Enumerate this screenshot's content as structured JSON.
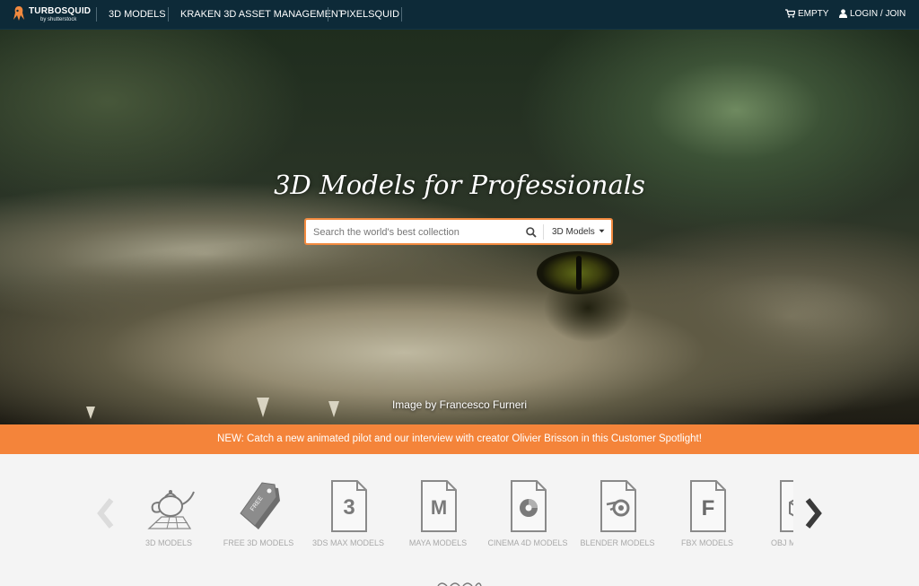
{
  "nav": {
    "logo_text": "TURBOSQUID",
    "logo_sub": "by shutterstock",
    "links": [
      "3D MODELS",
      "KRAKEN 3D ASSET MANAGEMENT",
      "PIXELSQUID"
    ],
    "cart_label": "EMPTY",
    "login_label": "LOGIN / JOIN",
    "cart_icon": "cart-icon",
    "user_icon": "user-icon"
  },
  "hero": {
    "title": "3D Models for Professionals",
    "search": {
      "placeholder": "Search the world's best collection",
      "category": "3D Models",
      "search_icon": "search-icon",
      "caret_icon": "caret-down-icon"
    },
    "credit": "Image by Francesco Furneri"
  },
  "banner": {
    "text": "NEW: Catch a new animated pilot and our interview with creator Olivier Brisson in this Customer Spotlight!"
  },
  "categories": {
    "prev_icon": "chevron-left-icon",
    "next_icon": "chevron-right-icon",
    "items": [
      {
        "label": "3D MODELS",
        "icon": "teapot-icon"
      },
      {
        "label": "FREE 3D MODELS",
        "icon": "free-tag-icon"
      },
      {
        "label": "3DS MAX MODELS",
        "icon": "3dsmax-file-icon"
      },
      {
        "label": "MAYA MODELS",
        "icon": "maya-file-icon"
      },
      {
        "label": "CINEMA 4D MODELS",
        "icon": "cinema4d-file-icon"
      },
      {
        "label": "BLENDER MODELS",
        "icon": "blender-file-icon"
      },
      {
        "label": "FBX MODELS",
        "icon": "fbx-file-icon"
      },
      {
        "label": "OBJ MODELS",
        "icon": "obj-file-icon"
      }
    ]
  },
  "colors": {
    "nav_bg": "#0d2a38",
    "accent_orange": "#f4843a",
    "search_border": "#f28a3f",
    "category_text": "#a9a9a9"
  }
}
